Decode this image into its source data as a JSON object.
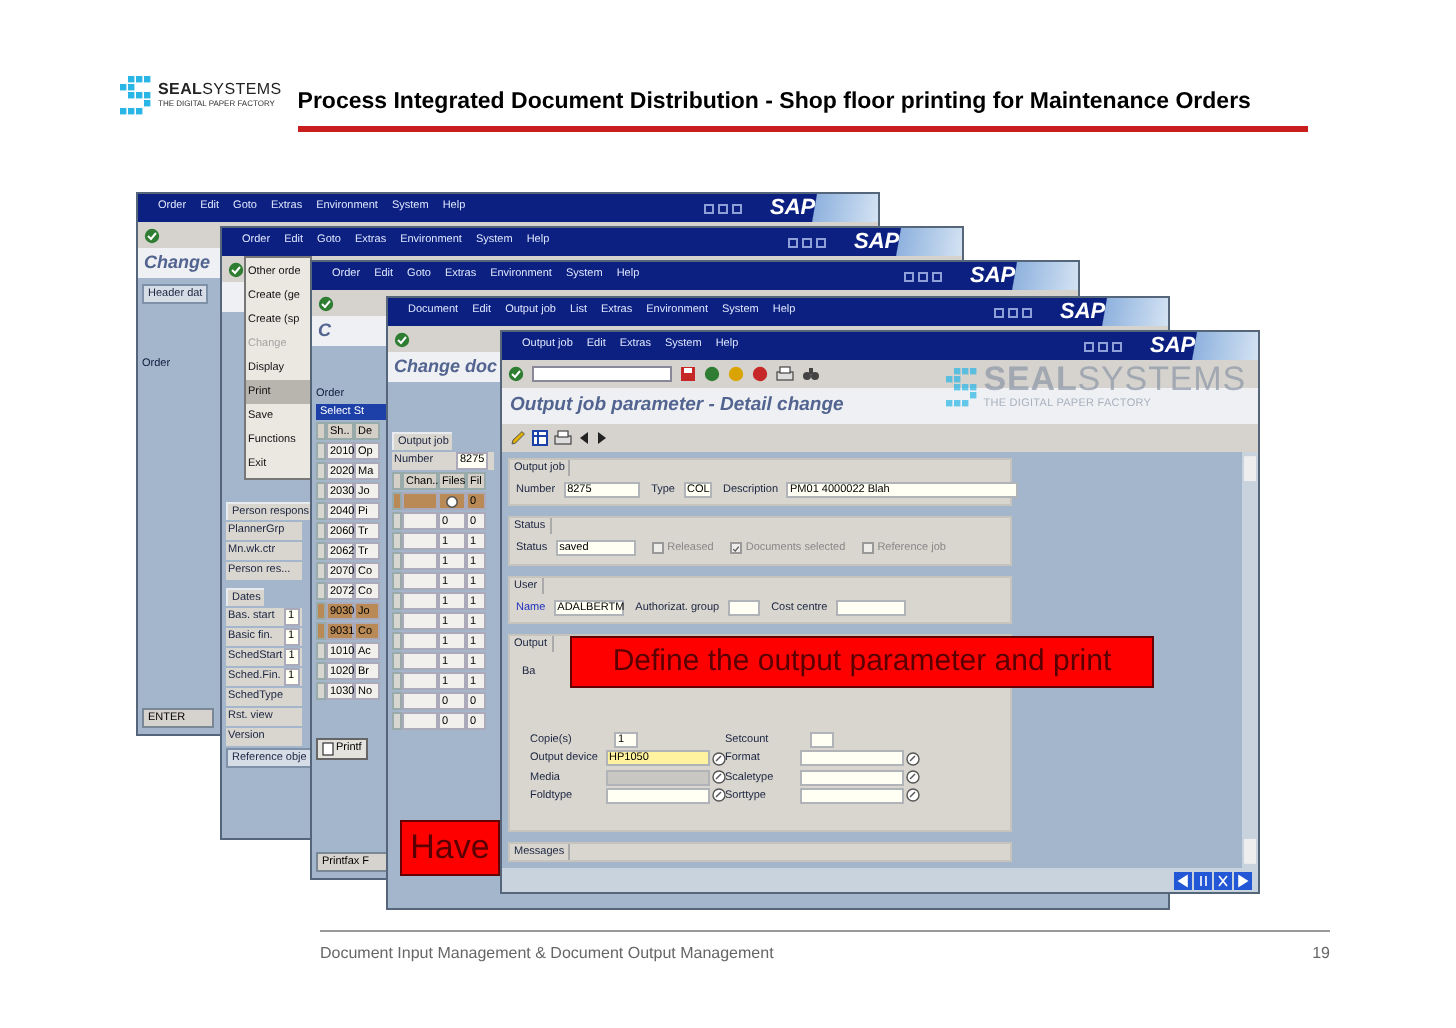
{
  "slide": {
    "logo": {
      "name": "**SEAL**SYSTEMS",
      "tagline": "THE DIGITAL PAPER FACTORY"
    },
    "title": "Process Integrated Document Distribution - Shop floor printing for Maintenance Orders",
    "footer": "Document Input Management & Document Output Management",
    "page": "19"
  },
  "windows": [
    {
      "menu": [
        "Order",
        "Edit",
        "Goto",
        "Extras",
        "Environment",
        "System",
        "Help"
      ],
      "logo": "SAP",
      "title": "Change",
      "items": [
        {
          "kind": "tab",
          "text": "Header dat"
        },
        {
          "kind": "label",
          "text": "Order"
        }
      ],
      "status": "ENTER"
    },
    {
      "menu": [
        "Order",
        "Edit",
        "Goto",
        "Extras",
        "Environment",
        "System",
        "Help"
      ],
      "logo": "SAP",
      "dropdown": [
        {
          "label": "Other orde",
          "disabled": false,
          "selected": false
        },
        {
          "label": "Create (ge",
          "disabled": false,
          "selected": false
        },
        {
          "label": "Create (sp",
          "disabled": false,
          "selected": false
        },
        {
          "label": "Change",
          "disabled": true,
          "selected": false
        },
        {
          "label": "Display",
          "disabled": false,
          "selected": false
        },
        {
          "label": "Print",
          "disabled": false,
          "selected": true
        },
        {
          "label": "Save",
          "disabled": false,
          "selected": false
        },
        {
          "label": "Functions",
          "disabled": false,
          "selected": false
        },
        {
          "label": "Exit",
          "disabled": false,
          "selected": false
        }
      ],
      "items": [
        {
          "kind": "group",
          "text": "Person respons"
        },
        {
          "kind": "field",
          "label": "PlannerGrp"
        },
        {
          "kind": "field",
          "label": "Mn.wk.ctr"
        },
        {
          "kind": "field",
          "label": "Person res..."
        },
        {
          "kind": "group",
          "text": "Dates"
        },
        {
          "kind": "field",
          "label": "Bas. start",
          "value": "1"
        },
        {
          "kind": "field",
          "label": "Basic fin.",
          "value": "1"
        },
        {
          "kind": "field",
          "label": "SchedStart",
          "value": "1"
        },
        {
          "kind": "field",
          "label": "Sched.Fin.",
          "value": "1"
        },
        {
          "kind": "field",
          "label": "SchedType"
        },
        {
          "kind": "field",
          "label": "Rst. view"
        },
        {
          "kind": "field",
          "label": "Version"
        },
        {
          "kind": "tab",
          "text": "Reference obje"
        }
      ]
    },
    {
      "menu": [
        "Order",
        "Edit",
        "Goto",
        "Extras",
        "Environment",
        "System",
        "Help"
      ],
      "logo": "SAP",
      "title": "C",
      "items": [
        {
          "kind": "label",
          "text": "Order"
        },
        {
          "kind": "bar",
          "text": "Select St"
        },
        {
          "kind": "header",
          "cells": [
            "Sh..",
            "De"
          ]
        },
        {
          "kind": "row",
          "cells": [
            "2010",
            "Op"
          ],
          "selected": false
        },
        {
          "kind": "row",
          "cells": [
            "2020",
            "Ma"
          ],
          "selected": false
        },
        {
          "kind": "row",
          "cells": [
            "2030",
            "Jo"
          ],
          "selected": false
        },
        {
          "kind": "row",
          "cells": [
            "2040",
            "Pi"
          ],
          "selected": false
        },
        {
          "kind": "row",
          "cells": [
            "2060",
            "Tr"
          ],
          "selected": false
        },
        {
          "kind": "row",
          "cells": [
            "2062",
            "Tr"
          ],
          "selected": false
        },
        {
          "kind": "row",
          "cells": [
            "2070",
            "Co"
          ],
          "selected": false
        },
        {
          "kind": "row",
          "cells": [
            "2072",
            "Co"
          ],
          "selected": false
        },
        {
          "kind": "row",
          "cells": [
            "9030",
            "Jo"
          ],
          "selected": true
        },
        {
          "kind": "row",
          "cells": [
            "9031",
            "Co"
          ],
          "selected": true
        },
        {
          "kind": "row",
          "cells": [
            "1010",
            "Ac"
          ],
          "selected": false
        },
        {
          "kind": "row",
          "cells": [
            "1020",
            "Br"
          ],
          "selected": false
        },
        {
          "kind": "row",
          "cells": [
            "1030",
            "No"
          ],
          "selected": false
        },
        {
          "kind": "button",
          "text": "Printf"
        }
      ],
      "status": "Printfax F"
    },
    {
      "menu": [
        "Document",
        "Edit",
        "Output job",
        "List",
        "Extras",
        "Environment",
        "System",
        "Help"
      ],
      "logo": "SAP",
      "title": "Change doc",
      "items": [
        {
          "kind": "group",
          "text": "Output job"
        },
        {
          "kind": "field",
          "label": "Number",
          "value": "8275"
        },
        {
          "kind": "header",
          "cells": [
            "Chan..",
            "Files",
            "Fil"
          ]
        },
        {
          "kind": "row",
          "cells": [
            "0"
          ],
          "icon": true,
          "selected": true
        },
        {
          "kind": "row",
          "cells": [
            "0",
            "0"
          ],
          "selected": false
        },
        {
          "kind": "row",
          "cells": [
            "1",
            "1"
          ],
          "selected": false
        },
        {
          "kind": "row",
          "cells": [
            "1",
            "1"
          ],
          "selected": false
        },
        {
          "kind": "row",
          "cells": [
            "1",
            "1"
          ],
          "selected": false
        },
        {
          "kind": "row",
          "cells": [
            "1",
            "1"
          ],
          "selected": false
        },
        {
          "kind": "row",
          "cells": [
            "1",
            "1"
          ],
          "selected": false
        },
        {
          "kind": "row",
          "cells": [
            "1",
            "1"
          ],
          "selected": false
        },
        {
          "kind": "row",
          "cells": [
            "1",
            "1"
          ],
          "selected": false
        },
        {
          "kind": "row",
          "cells": [
            "1",
            "1"
          ],
          "selected": false
        },
        {
          "kind": "row",
          "cells": [
            "0",
            "0"
          ],
          "selected": false
        },
        {
          "kind": "row",
          "cells": [
            "0",
            "0"
          ],
          "selected": false
        }
      ]
    }
  ],
  "detail": {
    "menu": [
      "Output job",
      "Edit",
      "Extras",
      "System",
      "Help"
    ],
    "logo": "SAP",
    "overlay_logo": {
      "name": "**SEAL**SYSTEMS",
      "tagline": "THE DIGITAL PAPER FACTORY"
    },
    "title": "Output job parameter - Detail change",
    "groups": [
      {
        "title": "Output job",
        "kind": "fields",
        "fields": [
          {
            "label": "Number",
            "value": "8275"
          },
          {
            "label": "Type",
            "value": "COL"
          },
          {
            "label": "Description",
            "value": "PM01 4000022 Blah"
          }
        ]
      },
      {
        "title": "Status",
        "kind": "status",
        "fields": [
          {
            "label": "Status",
            "value": "saved"
          }
        ],
        "checks": [
          {
            "label": "Released",
            "checked": false
          },
          {
            "label": "Documents selected",
            "checked": true
          },
          {
            "label": "Reference job",
            "checked": false
          }
        ]
      },
      {
        "title": "User",
        "kind": "fields",
        "fields": [
          {
            "label": "Name",
            "value": "ADALBERTM",
            "emphasis": true
          },
          {
            "label": "Authorizat. group"
          },
          {
            "label": "Cost centre"
          }
        ]
      },
      {
        "title": "Output",
        "kind": "grid",
        "tab": "Ba",
        "fields": [
          {
            "label": "Copie(s)",
            "value": "1"
          },
          {
            "label": "Setcount"
          },
          {
            "label": "Output device",
            "value": "HP1050",
            "lookup": true,
            "highlighted": true
          },
          {
            "label": "Format",
            "lookup": true
          },
          {
            "label": "Media",
            "lookup": true,
            "disabled": true
          },
          {
            "label": "Scaletype",
            "lookup": true
          },
          {
            "label": "Foldtype",
            "lookup": true
          },
          {
            "label": "Sorttype",
            "lookup": true
          }
        ]
      },
      {
        "title": "Messages",
        "kind": "fields"
      }
    ]
  },
  "callouts": [
    {
      "text": "Have"
    },
    {
      "text": "Define the output parameter and print"
    }
  ]
}
